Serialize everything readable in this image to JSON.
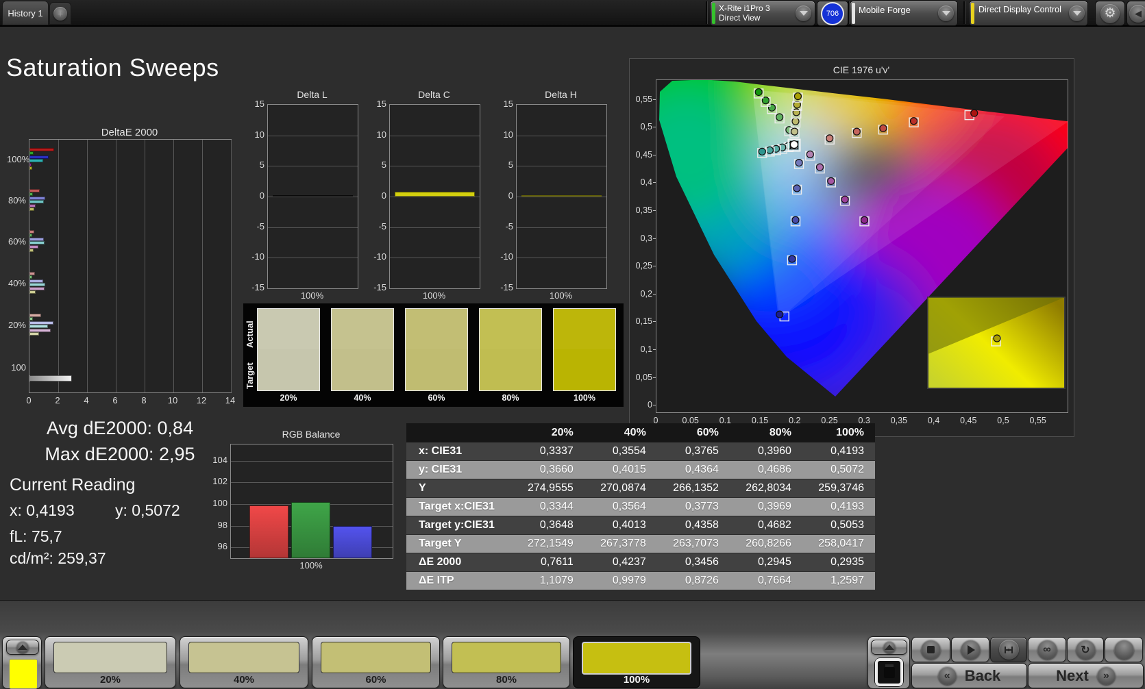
{
  "top_bar": {
    "tab": "History 1",
    "add_tab": "+",
    "meter": {
      "line1": "X-Rite i1Pro 3",
      "line2": "Direct View",
      "accent": "#35c12d"
    },
    "badge": "706",
    "badge_color": "#1532d6",
    "source": {
      "label": "Mobile Forge",
      "accent": "#e2e2e2"
    },
    "workflow": {
      "label": "Direct Display Control",
      "accent": "#e8d21f"
    }
  },
  "title": "Saturation Sweeps",
  "summary": {
    "avg": "Avg dE2000: 0,84",
    "max": "Max dE2000: 2,95"
  },
  "current_reading": {
    "heading": "Current Reading",
    "x": "x: 0,4193",
    "y": "y: 0,5072",
    "fl": "fL: 75,7",
    "cdm2": "cd/m²: 259,37"
  },
  "swatch_panel": {
    "actual_label": "Actual",
    "target_label": "Target",
    "items": [
      {
        "label": "20%",
        "actual": "#c9c9b1",
        "target": "#c6c6ad"
      },
      {
        "label": "40%",
        "actual": "#c5c28f",
        "target": "#c2bf8b"
      },
      {
        "label": "60%",
        "actual": "#c2be74",
        "target": "#c0bc71"
      },
      {
        "label": "80%",
        "actual": "#c2bf53",
        "target": "#c0bd51"
      },
      {
        "label": "100%",
        "actual": "#bdb60a",
        "target": "#bab402"
      }
    ]
  },
  "table": {
    "columns": [
      "20%",
      "40%",
      "60%",
      "80%",
      "100%"
    ],
    "rows": [
      {
        "label": "x: CIE31",
        "values": [
          "0,3337",
          "0,3554",
          "0,3765",
          "0,3960",
          "0,4193"
        ]
      },
      {
        "label": "y: CIE31",
        "values": [
          "0,3660",
          "0,4015",
          "0,4364",
          "0,4686",
          "0,5072"
        ]
      },
      {
        "label": "Y",
        "values": [
          "274,9555",
          "270,0874",
          "266,1352",
          "262,8034",
          "259,3746"
        ]
      },
      {
        "label": "Target x:CIE31",
        "values": [
          "0,3344",
          "0,3564",
          "0,3773",
          "0,3969",
          "0,4193"
        ]
      },
      {
        "label": "Target y:CIE31",
        "values": [
          "0,3648",
          "0,4013",
          "0,4358",
          "0,4682",
          "0,5053"
        ]
      },
      {
        "label": "Target Y",
        "values": [
          "272,1549",
          "267,3778",
          "263,7073",
          "260,8266",
          "258,0417"
        ]
      },
      {
        "label": "ΔE 2000",
        "values": [
          "0,7611",
          "0,4237",
          "0,3456",
          "0,2945",
          "0,2935"
        ]
      },
      {
        "label": "ΔE ITP",
        "values": [
          "1,1079",
          "0,9979",
          "0,8726",
          "0,7664",
          "1,2597"
        ]
      }
    ]
  },
  "bottom_bar": {
    "patches": [
      {
        "label": "20%",
        "color": "#cbcbb3",
        "selected": false
      },
      {
        "label": "40%",
        "color": "#c6c392",
        "selected": false
      },
      {
        "label": "60%",
        "color": "#c3bf75",
        "selected": false
      },
      {
        "label": "80%",
        "color": "#c2bf53",
        "selected": false
      },
      {
        "label": "100%",
        "color": "#c6bf11",
        "selected": true
      }
    ],
    "preview_color": "#ffff00",
    "back_label": "Back",
    "next_label": "Next",
    "back_glyph": "«",
    "next_glyph": "»",
    "infinity_glyph": "∞",
    "refresh_glyph": "↻"
  },
  "chart_data": [
    {
      "id": "deltae2000",
      "type": "bar",
      "orientation": "horizontal",
      "title": "DeltaE 2000",
      "xlim": [
        0,
        14
      ],
      "xticks": [
        0,
        2,
        4,
        6,
        8,
        10,
        12,
        14
      ],
      "groups": [
        {
          "label": "100%",
          "values": [
            1.73,
            0.29,
            1.33,
            0.93,
            0.13,
            0.21
          ],
          "colors": [
            "#b81c1c",
            "#2ca32c",
            "#2a2ec0",
            "#2fb3b3",
            "#8e2a8e",
            "#b5b52a"
          ]
        },
        {
          "label": "80%",
          "values": [
            0.72,
            0.24,
            1.09,
            0.98,
            0.45,
            0.32
          ],
          "colors": [
            "#c05858",
            "#4fae4f",
            "#7e82d4",
            "#6fc3c3",
            "#b36fb3",
            "#bcbc62"
          ]
        },
        {
          "label": "60%",
          "values": [
            0.32,
            0.19,
            0.98,
            1.04,
            0.61,
            0.29
          ],
          "colors": [
            "#c97e7e",
            "#63b563",
            "#9a9ddc",
            "#86cdcd",
            "#c08ac0",
            "#c5c57c"
          ]
        },
        {
          "label": "40%",
          "values": [
            0.4,
            0.21,
            0.93,
            1.09,
            1.04,
            0.42
          ],
          "colors": [
            "#cf9494",
            "#79c179",
            "#abaee2",
            "#9bd6d6",
            "#cb9fcb",
            "#cdcd92"
          ]
        },
        {
          "label": "20%",
          "values": [
            0.82,
            0.24,
            1.68,
            1.3,
            1.46,
            0.69
          ],
          "colors": [
            "#d6aba4",
            "#90cd90",
            "#babce8",
            "#afdfdf",
            "#d7b4d7",
            "#d5d5a8"
          ]
        },
        {
          "label": "100",
          "values": [
            2.93
          ],
          "colors": [
            "#f2f2f2"
          ]
        }
      ]
    },
    {
      "id": "delta_l",
      "type": "bar",
      "title": "Delta L",
      "ylim": [
        -15,
        15
      ],
      "yticks": [
        15,
        10,
        5,
        0,
        -5,
        -10,
        -15
      ],
      "categories": [
        "100%"
      ],
      "values": [
        0.25
      ],
      "color": "#141414"
    },
    {
      "id": "delta_c",
      "type": "bar",
      "title": "Delta C",
      "ylim": [
        -15,
        15
      ],
      "yticks": [
        15,
        10,
        5,
        0,
        -5,
        -10,
        -15
      ],
      "categories": [
        "100%"
      ],
      "values": [
        0.8
      ],
      "color": "#d4d00e"
    },
    {
      "id": "delta_h",
      "type": "bar",
      "title": "Delta H",
      "ylim": [
        -15,
        15
      ],
      "yticks": [
        15,
        10,
        5,
        0,
        -5,
        -10,
        -15
      ],
      "categories": [
        "100%"
      ],
      "values": [
        0.2
      ],
      "color": "#d4d00e"
    },
    {
      "id": "rgb_balance",
      "type": "bar",
      "title": "RGB Balance",
      "ylim": [
        95,
        105.5
      ],
      "yticks": [
        104,
        102,
        100,
        98,
        96
      ],
      "categories": [
        "100%"
      ],
      "series": [
        {
          "name": "red",
          "value": 99.9,
          "color": "#f04848"
        },
        {
          "name": "green",
          "value": 100.2,
          "color": "#3fa548"
        },
        {
          "name": "blue",
          "value": 98.0,
          "color": "#5353ee"
        }
      ]
    },
    {
      "id": "cie",
      "type": "scatter",
      "title": "CIE 1976 u'v'",
      "xlim": [
        0,
        0.591
      ],
      "ylim": [
        0,
        0.585
      ],
      "xticks": [
        "0",
        "0,05",
        "0,1",
        "0,15",
        "0,2",
        "0,25",
        "0,3",
        "0,35",
        "0,4",
        "0,45",
        "0,5",
        "0,55"
      ],
      "yticks": [
        "0,55",
        "0,5",
        "0,45",
        "0,4",
        "0,35",
        "0,3",
        "0,25",
        "0,2",
        "0,15",
        "0,1",
        "0,05",
        "0"
      ],
      "white_point": {
        "u": 0.198,
        "v": 0.468
      },
      "series": [
        {
          "name": "green-sweep",
          "points": [
            [
              0.191,
              0.493
            ],
            [
              0.177,
              0.516
            ],
            [
              0.166,
              0.533
            ],
            [
              0.157,
              0.546
            ],
            [
              0.147,
              0.561
            ]
          ],
          "colors": [
            "#7dbb7d",
            "#60b160",
            "#46a846",
            "#2f9f2f",
            "#15950f"
          ]
        },
        {
          "name": "yellow-sweep",
          "points": [
            [
              0.1985,
              0.49
            ],
            [
              0.2,
              0.5084
            ],
            [
              0.2012,
              0.5248
            ],
            [
              0.2023,
              0.5385
            ],
            [
              0.2034,
              0.5535
            ]
          ],
          "colors": [
            "#c2c08c",
            "#bdb96e",
            "#b8b252",
            "#b2aa34",
            "#aaa004"
          ]
        },
        {
          "name": "red-sweep",
          "points": [
            [
              0.249,
              0.478
            ],
            [
              0.288,
              0.49
            ],
            [
              0.326,
              0.496
            ],
            [
              0.37,
              0.509
            ],
            [
              0.45,
              0.522
            ]
          ],
          "colors": [
            "#c98078",
            "#c5655c",
            "#c04a42",
            "#ba2f28",
            "#ad1410"
          ],
          "last_offset": [
            7,
            -3
          ]
        },
        {
          "name": "cyan-sweep",
          "points": [
            [
              0.19,
              0.4645
            ],
            [
              0.181,
              0.4615
            ],
            [
              0.172,
              0.459
            ],
            [
              0.163,
              0.4565
            ],
            [
              0.152,
              0.454
            ]
          ],
          "colors": [
            "#7cbcb6",
            "#6bb5ae",
            "#59ada6",
            "#46a49d",
            "#2f968f"
          ]
        },
        {
          "name": "magenta-sweep",
          "points": [
            [
              0.221,
              0.449
            ],
            [
              0.235,
              0.426
            ],
            [
              0.251,
              0.401
            ],
            [
              0.271,
              0.368
            ],
            [
              0.299,
              0.331
            ]
          ],
          "colors": [
            "#b382b1",
            "#ac6daa",
            "#a557a3",
            "#9d419b",
            "#8e288c"
          ]
        },
        {
          "name": "blue-sweep",
          "points": [
            [
              0.205,
              0.434
            ],
            [
              0.202,
              0.388
            ],
            [
              0.2,
              0.331
            ],
            [
              0.195,
              0.261
            ],
            [
              0.184,
              0.16
            ]
          ],
          "colors": [
            "#7279bc",
            "#5c63b3",
            "#474caa",
            "#3336a1",
            "#1b1d90"
          ],
          "last_offset": [
            -7,
            -3
          ]
        }
      ],
      "inset_zoom": {
        "marker_u": 0.2034,
        "marker_v": 0.5535,
        "marker_color": "#ab9f04"
      }
    }
  ]
}
